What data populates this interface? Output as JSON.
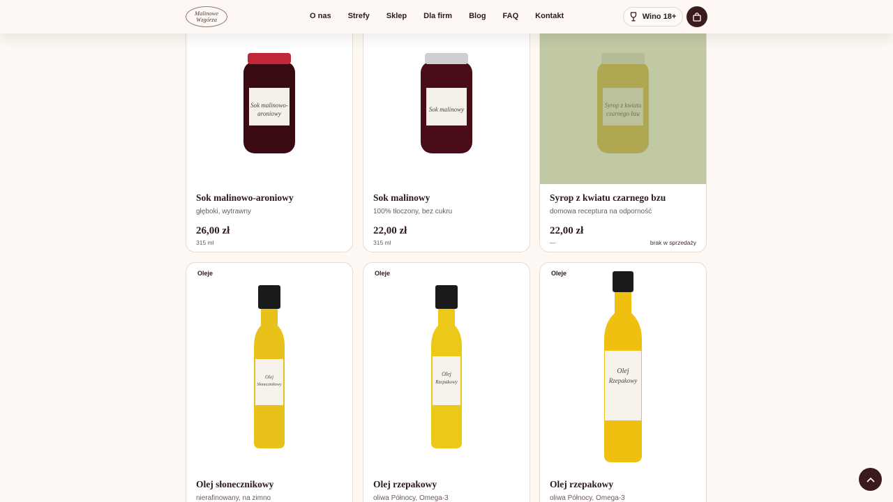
{
  "header": {
    "logo_text": "Malinowe Wzgórza",
    "nav": [
      "O nas",
      "Strefy",
      "Sklep",
      "Dla firm",
      "Blog",
      "FAQ",
      "Kontakt"
    ],
    "wine_label": "Wino 18+"
  },
  "products": [
    {
      "name": "Sok malinowo-aroniowy",
      "desc": "głęboki, wytrawny",
      "price": "26,00 zł",
      "size": "315 ml",
      "label_text": "Sok malinowo-aroniowy",
      "cap_color": "#c0283a",
      "liquid_color": "#3a0a12"
    },
    {
      "name": "Sok malinowy",
      "desc": "100% tłoczony, bez cukru",
      "price": "22,00 zł",
      "size": "315 ml",
      "label_text": "Sok malinowy",
      "cap_color": "#cfcfcf",
      "liquid_color": "#4a0c18"
    },
    {
      "name": "Syrop z kwiatu czarnego bzu",
      "desc": "domowa receptura na odporność",
      "price": "22,00 zł",
      "size": "—",
      "status": "brak w sprzedaży",
      "label_text": "Syrop z kwiatu czarnego bzu",
      "cap_color": "#e4e4e4",
      "liquid_color": "#d9b64a"
    },
    {
      "tag": "Oleje",
      "name": "Olej słonecznikowy",
      "desc": "nierafinowany, na zimno",
      "label_text": "Olej Słonecznikowy",
      "liquid_color": "#e8c21a"
    },
    {
      "tag": "Oleje",
      "name": "Olej rzepakowy",
      "desc": "oliwa Północy, Omega-3",
      "label_text": "Olej Rzepakowy",
      "liquid_color": "#ecc818"
    },
    {
      "tag": "Oleje",
      "name": "Olej rzepakowy",
      "desc": "oliwa Północy, Omega-3",
      "label_text": "Olej Rzepakowy",
      "liquid_color": "#f0c010"
    }
  ],
  "icons": {
    "wine": "wine-glass-icon",
    "cart": "shopping-bag-icon",
    "scroll": "chevron-up-icon"
  }
}
